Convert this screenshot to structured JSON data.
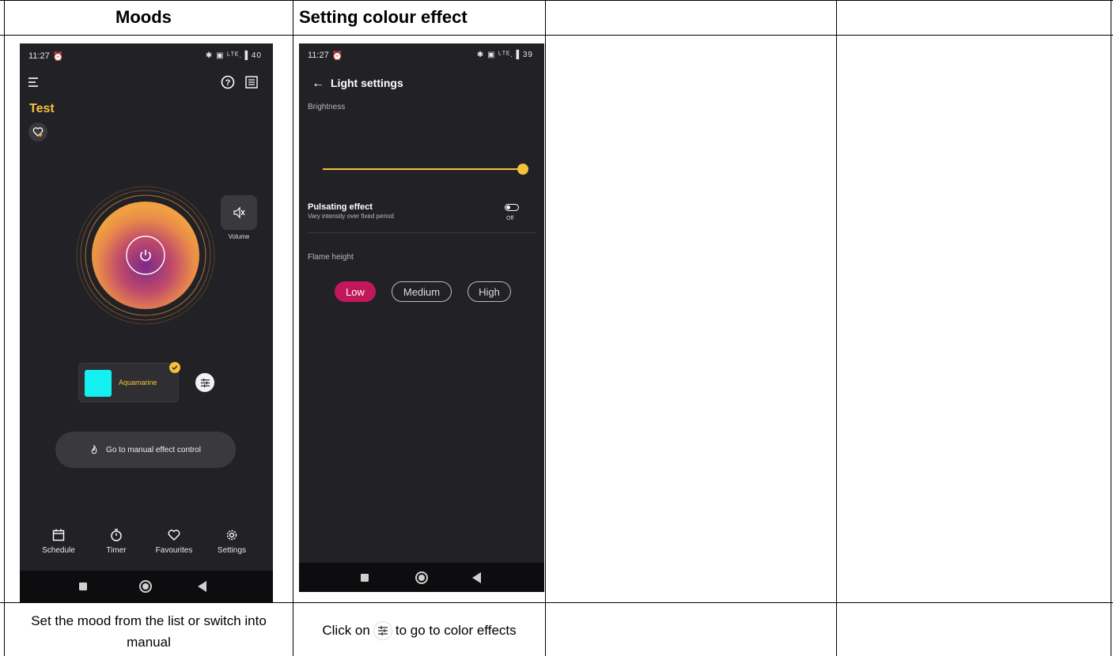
{
  "table": {
    "headers": [
      "Moods",
      "Setting colour effect",
      "",
      ""
    ],
    "captions": {
      "moods": "Set the mood from the list or switch into manual",
      "effect_prefix": "Click on",
      "effect_suffix": "to go to color effects"
    }
  },
  "phone1": {
    "status_time": "11:27",
    "status_right": "✱ ▣ ᴸᵀᴱ.▐ 40",
    "title": "Test",
    "volume_label": "Volume",
    "color_name": "Aquamarine",
    "color_swatch": "#14f0f0",
    "manual_button": "Go to manual effect control",
    "tabs": [
      "Schedule",
      "Timer",
      "Favourites",
      "Settings"
    ]
  },
  "phone2": {
    "status_time": "11:27",
    "status_right": "✱ ▣ ᴸᵀᴱ.▐ 39",
    "header": "Light settings",
    "brightness_label": "Brightness",
    "brightness_value": 1.0,
    "pulsating_title": "Pulsating effect",
    "pulsating_sub": "Vary intensity over fixed period",
    "pulsating_state": "Off",
    "flame_label": "Flame height",
    "flame_options": [
      "Low",
      "Medium",
      "High"
    ],
    "flame_selected": "Low"
  },
  "colors": {
    "accent_yellow": "#f5c13c",
    "accent_pink": "#c2185b",
    "phone_bg": "#222226"
  }
}
